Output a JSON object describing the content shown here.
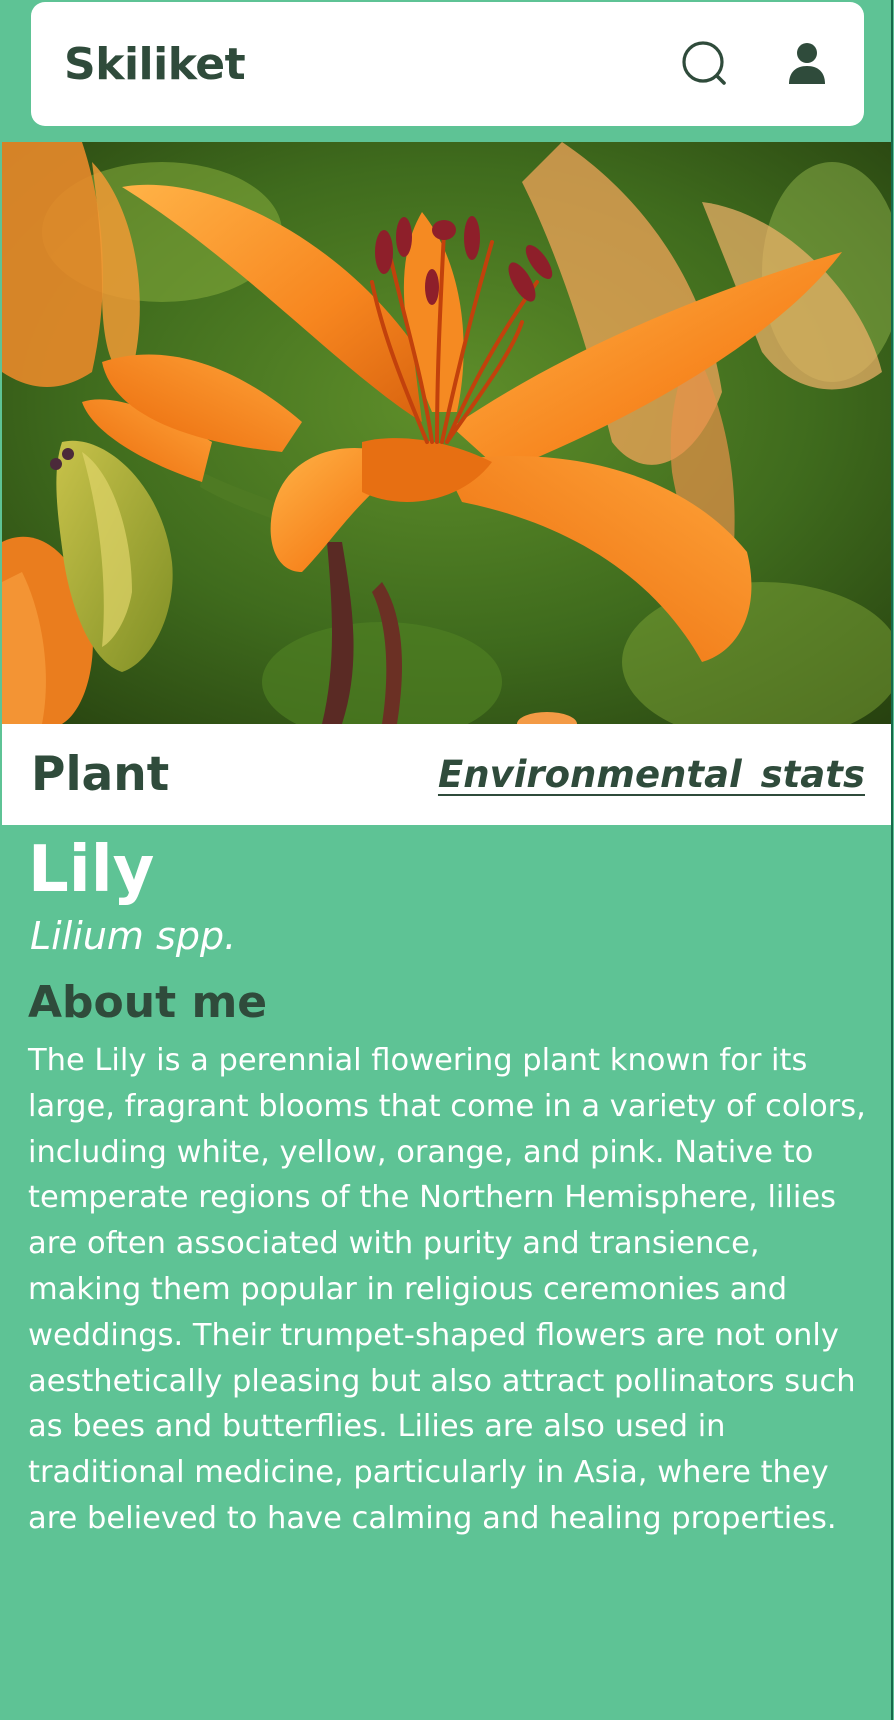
{
  "header": {
    "app_title": "Skiliket",
    "search_icon": "search-icon",
    "user_icon": "user-icon"
  },
  "hero": {
    "image": "orange-lily-flower-photo"
  },
  "tabs": {
    "plant_label": "Plant",
    "environmental_label": "Environmental stats"
  },
  "plant": {
    "name": "Lily",
    "scientific_name": "Lilium spp.",
    "about_heading": "About me",
    "about_text": "The Lily is a perennial flowering plant known for its large, fragrant blooms that come in a variety of colors, including white, yellow, orange, and pink. Native to temperate regions of the Northern Hemisphere, lilies are often associated with purity and transience, making them popular in religious ceremonies and weddings. Their trumpet-shaped flowers are not only aesthetically pleasing but also attract pollinators such as bees and butterflies. Lilies are also used in traditional medicine, particularly in Asia, where they are believed to have calming and healing properties."
  },
  "colors": {
    "background": "#5ec395",
    "header_bg": "#ffffff",
    "dark_text": "#2f4b3b",
    "light_text": "#ffffff"
  }
}
